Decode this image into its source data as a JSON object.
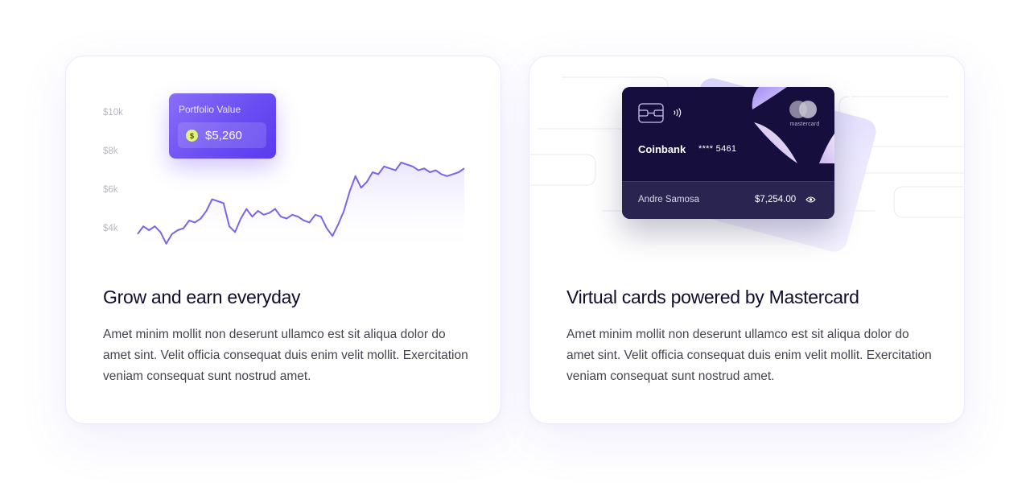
{
  "cards": [
    {
      "title": "Grow and earn everyday",
      "body": "Amet minim mollit non deserunt ullamco est sit aliqua dolor do amet sint. Velit officia consequat duis enim velit mollit. Exercitation veniam consequat sunt nostrud amet.",
      "portfolio": {
        "label": "Portfolio Value",
        "coin_symbol": "$",
        "value": "$5,260"
      }
    },
    {
      "title": "Virtual cards powered by Mastercard",
      "body": "Amet minim mollit non deserunt ullamco est sit aliqua dolor do amet sint. Velit officia consequat duis enim velit mollit. Exercitation veniam consequat sunt nostrud amet.",
      "virtual_card": {
        "bank": "Coinbank",
        "number": "**** 5461",
        "brand": "mastercard",
        "holder": "Andre Samosa",
        "balance": "$7,254.00"
      }
    }
  ],
  "chart_data": {
    "type": "area",
    "y_ticks": [
      "$10k",
      "$8k",
      "$6k",
      "$4k"
    ],
    "ylim": [
      3500,
      10500
    ],
    "y": [
      3800,
      4200,
      4000,
      4200,
      3900,
      3300,
      3800,
      4000,
      4100,
      4500,
      4400,
      4600,
      5000,
      5600,
      5500,
      5400,
      4200,
      3900,
      4600,
      5100,
      4700,
      5000,
      4800,
      4900,
      5100,
      4700,
      4600,
      4800,
      4700,
      4500,
      4400,
      4800,
      4700,
      4100,
      3700,
      4300,
      5000,
      6000,
      6800,
      6200,
      6500,
      7000,
      6900,
      7300,
      7200,
      7100,
      7500,
      7400,
      7300,
      7100,
      7200,
      7000,
      7100,
      6900,
      6800,
      6900,
      7000,
      7200
    ],
    "line_color": "#7c63e8",
    "fill_color": "#ece8fb"
  },
  "colors": {
    "accent": "#6b4ef2",
    "card_dark": "#160f3e",
    "coin": "#dff57a"
  }
}
